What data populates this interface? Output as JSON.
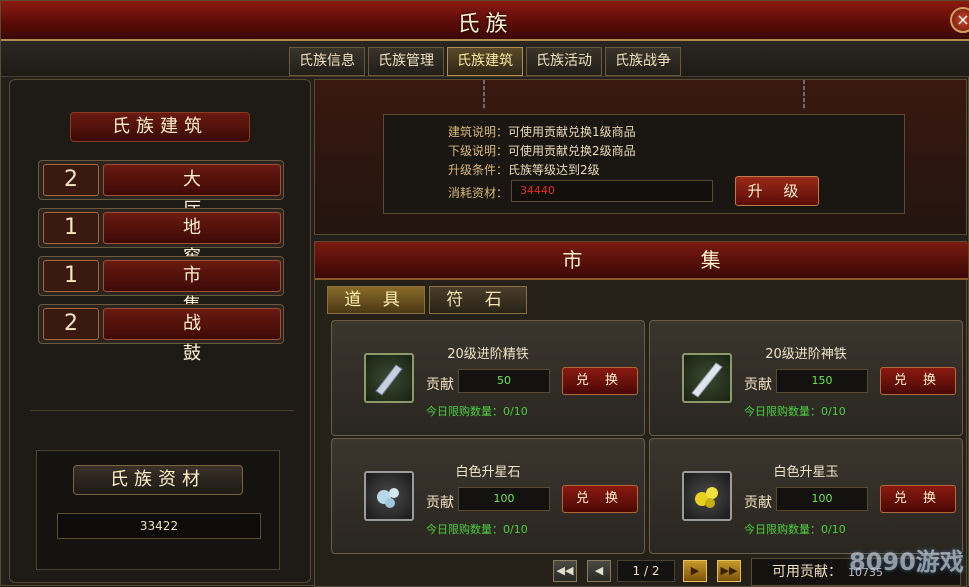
{
  "window": {
    "title": "氏族",
    "close": "×"
  },
  "tabs": [
    "氏族信息",
    "氏族管理",
    "氏族建筑",
    "氏族活动",
    "氏族战争"
  ],
  "left": {
    "header": "氏族建筑",
    "buildings": [
      {
        "level": "2",
        "name": "大 厅"
      },
      {
        "level": "1",
        "name": "地 窖"
      },
      {
        "level": "1",
        "name": "市 集"
      },
      {
        "level": "2",
        "name": "战 鼓"
      }
    ],
    "materials": {
      "title": "氏族资材",
      "value": "33422"
    }
  },
  "info": {
    "lines": [
      {
        "key": "建筑说明：",
        "val": "可使用贡献兑换1级商品"
      },
      {
        "key": "下级说明：",
        "val": "可使用贡献兑换2级商品"
      },
      {
        "key": "升级条件：",
        "val": "氏族等级达到2级"
      }
    ],
    "cost_label": "消耗资材：",
    "cost_value": "34440",
    "upgrade": "升 级"
  },
  "market": {
    "title": "市 集",
    "subtabs": [
      "道 具",
      "符 石"
    ],
    "items": [
      {
        "name": "20级进阶精铁",
        "label": "贡献",
        "cost": "50",
        "button": "兑 换",
        "limit": "今日限购数量：0/10",
        "icon": "iron-bar-icon"
      },
      {
        "name": "20级进阶神铁",
        "label": "贡献",
        "cost": "150",
        "button": "兑 换",
        "limit": "今日限购数量：0/10",
        "icon": "divine-iron-icon"
      },
      {
        "name": "白色升星石",
        "label": "贡献",
        "cost": "100",
        "button": "兑 换",
        "limit": "今日限购数量：0/10",
        "icon": "star-stone-icon"
      },
      {
        "name": "白色升星玉",
        "label": "贡献",
        "cost": "100",
        "button": "兑 换",
        "limit": "今日限购数量：0/10",
        "icon": "star-jade-icon"
      }
    ],
    "pager": {
      "first": "◀◀",
      "prev": "◀",
      "page": "1 / 2",
      "next": "▶",
      "last": "▶▶"
    },
    "available_label": "可用贡献：",
    "available_value": "10735"
  },
  "logo": "8090游戏"
}
